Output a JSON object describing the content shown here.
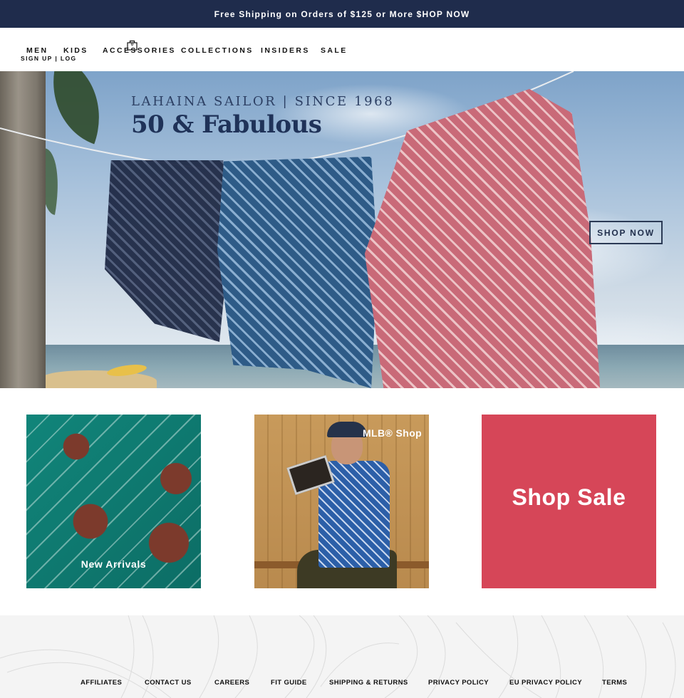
{
  "announcement": {
    "text": "Free Shipping on Orders of $125 or More $HOP NOW"
  },
  "header": {
    "account": {
      "signup_label": "SIGN UP",
      "separator": "|",
      "login_label": "LOG IN"
    },
    "cart": {
      "icon": "shopping-bag-icon",
      "count": "0"
    },
    "nav": [
      {
        "label": "MEN"
      },
      {
        "label": "KIDS"
      },
      {
        "label": "ACCESSORIES"
      },
      {
        "label": "COLLECTIONS"
      },
      {
        "label": "INSIDERS"
      },
      {
        "label": "SALE"
      }
    ]
  },
  "hero": {
    "kicker": "LAHAINA SAILOR | SINCE 1968",
    "heading": "50 & Fabulous",
    "cta_label": "SHOP NOW",
    "title_color": "#1f3258"
  },
  "tiles": [
    {
      "label": "New Arrivals"
    },
    {
      "label": "MLB® Shop"
    },
    {
      "label": "Shop Sale",
      "color": "#d64658"
    }
  ],
  "footer": {
    "links": [
      {
        "label": "AFFILIATES"
      },
      {
        "label": "CONTACT US"
      },
      {
        "label": "CAREERS"
      },
      {
        "label": "FIT GUIDE"
      },
      {
        "label": "SHIPPING & RETURNS"
      },
      {
        "label": "PRIVACY POLICY"
      },
      {
        "label": "EU PRIVACY POLICY"
      },
      {
        "label": "TERMS"
      }
    ]
  },
  "colors": {
    "announcement_bg": "#1f2c4c",
    "sale_tile": "#d64658",
    "footer_bg": "#f4f4f4"
  }
}
